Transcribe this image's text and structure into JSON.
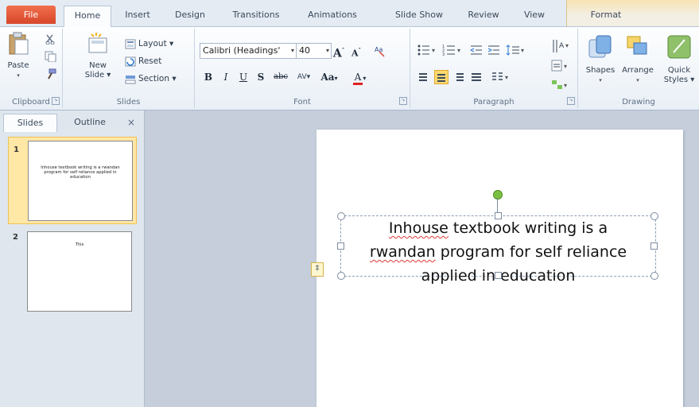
{
  "tabs": {
    "file": "File",
    "home": "Home",
    "insert": "Insert",
    "design": "Design",
    "transitions": "Transitions",
    "animations": "Animations",
    "slideshow": "Slide Show",
    "review": "Review",
    "view": "View",
    "format": "Format"
  },
  "ribbon": {
    "clipboard": {
      "label": "Clipboard",
      "paste": "Paste"
    },
    "slides": {
      "label": "Slides",
      "new_slide_1": "New",
      "new_slide_2": "Slide",
      "layout": "Layout",
      "reset": "Reset",
      "section": "Section"
    },
    "font": {
      "label": "Font",
      "font_name": "Calibri (Headings'",
      "font_size": "40",
      "bold": "B",
      "italic": "I",
      "underline": "U",
      "shadow": "S",
      "strike": "abc",
      "spacing": "AV",
      "case": "Aa",
      "color": "A"
    },
    "paragraph": {
      "label": "Paragraph"
    },
    "drawing": {
      "label": "Drawing",
      "shapes": "Shapes",
      "arrange": "Arrange",
      "quick_1": "Quick",
      "quick_2": "Styles"
    }
  },
  "panel": {
    "tab_slides": "Slides",
    "tab_outline": "Outline",
    "close": "×",
    "slides": [
      {
        "number": "1",
        "text": "Inhouse textbook writing is a rwandan program for self reliance applied in education"
      },
      {
        "number": "2",
        "text": "This"
      }
    ]
  },
  "slide": {
    "text_line1_a": "Inhouse",
    "text_line1_b": " textbook writing is a",
    "text_line2_a": "rwandan",
    "text_line2_b": " program for self reliance",
    "text_line3": "applied in education"
  },
  "colors": {
    "file_tab": "#d6472a",
    "selection": "#ffd86e",
    "rotate_handle": "#7bc043"
  }
}
